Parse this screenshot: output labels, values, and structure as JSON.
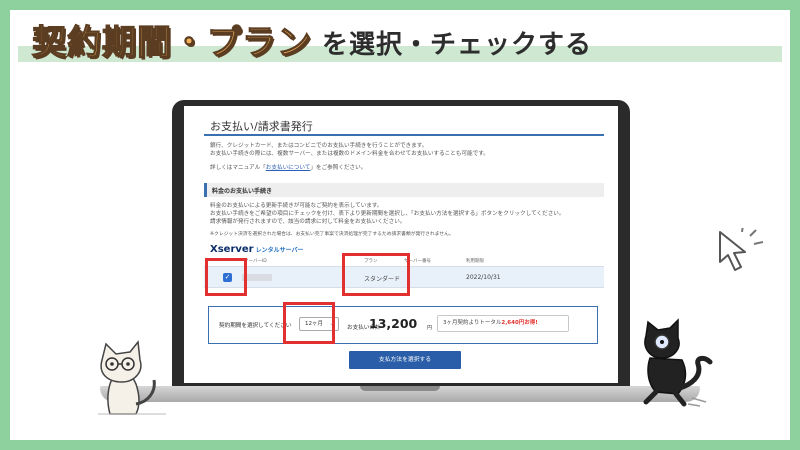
{
  "headline": {
    "main": "契約期間・プラン",
    "sub": "を選択・チェックする"
  },
  "screen": {
    "title": "お支払い/請求書発行",
    "intro_lines": [
      "銀行、クレジットカード、またはコンビニでのお支払い手続きを行うことができます。",
      "お支払い手続きの際には、複数サーバー、または複数のドメイン料金を合わせてお支払いすることも可能です。"
    ],
    "manual_prefix": "詳しくはマニュアル「",
    "manual_link": "お支払いについて",
    "manual_suffix": "」をご参照ください。",
    "section_heading": "料金のお支払い手続き",
    "section_lines": [
      "料金のお支払いによる更新手続きが可能なご契約を表示しています。",
      "お支払い手続きをご希望の項目にチェックを付け、表下より更新期間を選択し、「お支払い方法を選択する」ボタンをクリックしてください。",
      "請求情報が発行されますので、該当の請求に対して料金をお支払いください。"
    ],
    "credit_note": "※クレジット決済を選択された場合は、お支払い完了事案で決済処理が完了するため請求書類が発行されません。",
    "service_name": "Xserver",
    "service_sub": "レンタルサーバー",
    "columns": {
      "server_id": "サーバーID",
      "plan": "プラン",
      "server_number": "サーバー番号",
      "expiry": "利用期限"
    },
    "row": {
      "checked": true,
      "check_mark": "✓",
      "plan": "スタンダード",
      "expiry": "2022/10/31"
    },
    "period": {
      "label": "契約期間を選択してください",
      "selected": "12ヶ月",
      "chevron": "⌄",
      "total_label": "お支払い合計",
      "total_value": "13,200",
      "currency": "円",
      "savings_prefix": "3ヶ月契約よりトータル",
      "savings_amount": "2,640円お得!"
    },
    "pay_button": "支払方法を選択する"
  },
  "colors": {
    "frame": "#8fd19e",
    "headline_fill": "#f6b15c",
    "accent_blue": "#3a6fb0",
    "highlight_red": "#e23030",
    "button_blue": "#2a5ea8"
  },
  "icons": {
    "cursor": "mouse-pointer-icon",
    "cat_left": "white-cat-illustration",
    "cat_right": "black-cat-illustration"
  }
}
